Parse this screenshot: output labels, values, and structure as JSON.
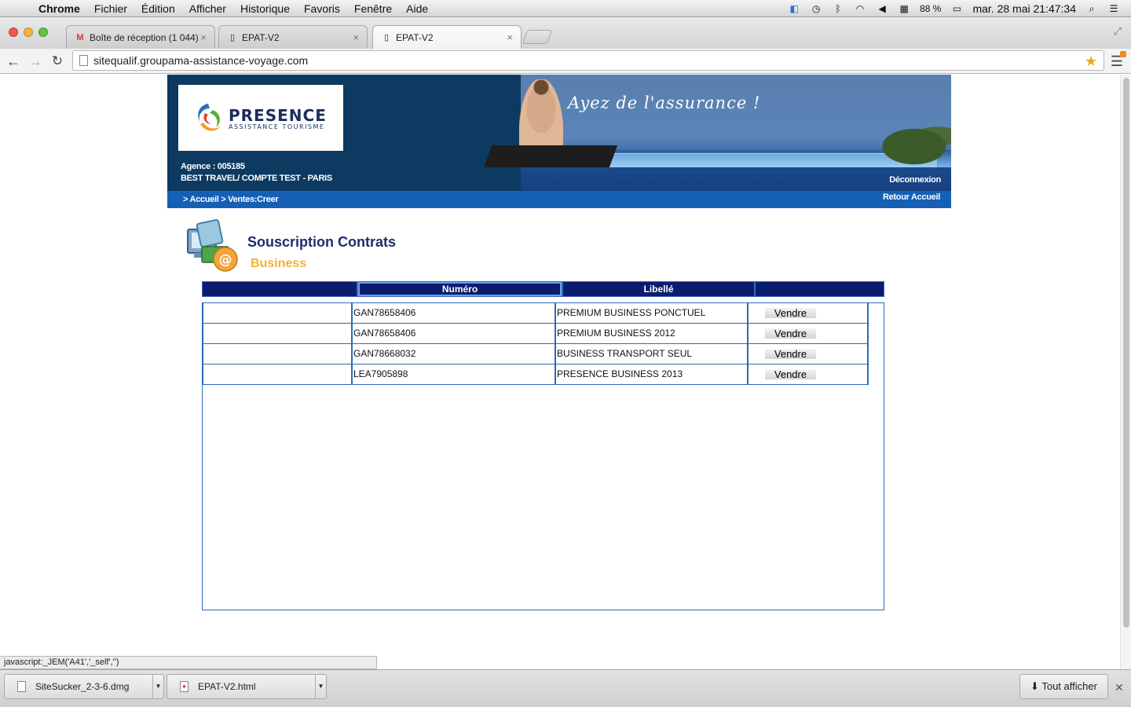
{
  "menubar": {
    "items": [
      "Chrome",
      "Fichier",
      "Édition",
      "Afficher",
      "Historique",
      "Favoris",
      "Fenêtre",
      "Aide"
    ],
    "battery": "88 %",
    "clock": "mar. 28 mai  21:47:34"
  },
  "tabs": [
    {
      "label": "Boîte de réception (1 044)",
      "icon": "gmail-icon"
    },
    {
      "label": "EPAT-V2",
      "icon": "page-icon"
    },
    {
      "label": "EPAT-V2",
      "icon": "page-icon"
    }
  ],
  "url": "sitequalif.groupama-assistance-voyage.com",
  "banner": {
    "slogan": "Ayez de l'assurance !",
    "logo": "PRESENCE",
    "logo_sub": "ASSISTANCE TOURISME",
    "agency_line1": "Agence :  005185",
    "agency_line2": "BEST TRAVEL/ COMPTE TEST - PARIS",
    "logout": "Déconnexion",
    "breadcrumb": "> Accueil > Ventes:Creer",
    "home": "Retour Accueil"
  },
  "section": {
    "title": "Souscription Contrats",
    "subtitle": "Business"
  },
  "table": {
    "headers": [
      "",
      "Numéro",
      "Libellé",
      ""
    ],
    "rows": [
      {
        "numero": "GAN78658406",
        "libelle": "PREMIUM BUSINESS PONCTUEL",
        "action": "Vendre"
      },
      {
        "numero": "GAN78658406",
        "libelle": "PREMIUM BUSINESS 2012",
        "action": "Vendre"
      },
      {
        "numero": "GAN78668032",
        "libelle": "BUSINESS TRANSPORT SEUL",
        "action": "Vendre"
      },
      {
        "numero": "LEA7905898",
        "libelle": "PRESENCE BUSINESS 2013",
        "action": "Vendre"
      }
    ]
  },
  "status_text": "javascript:_JEM('A41','_self','')",
  "downloads": {
    "items": [
      "SiteSucker_2-3-6.dmg",
      "EPAT-V2.html"
    ],
    "show_all": "Tout afficher"
  }
}
